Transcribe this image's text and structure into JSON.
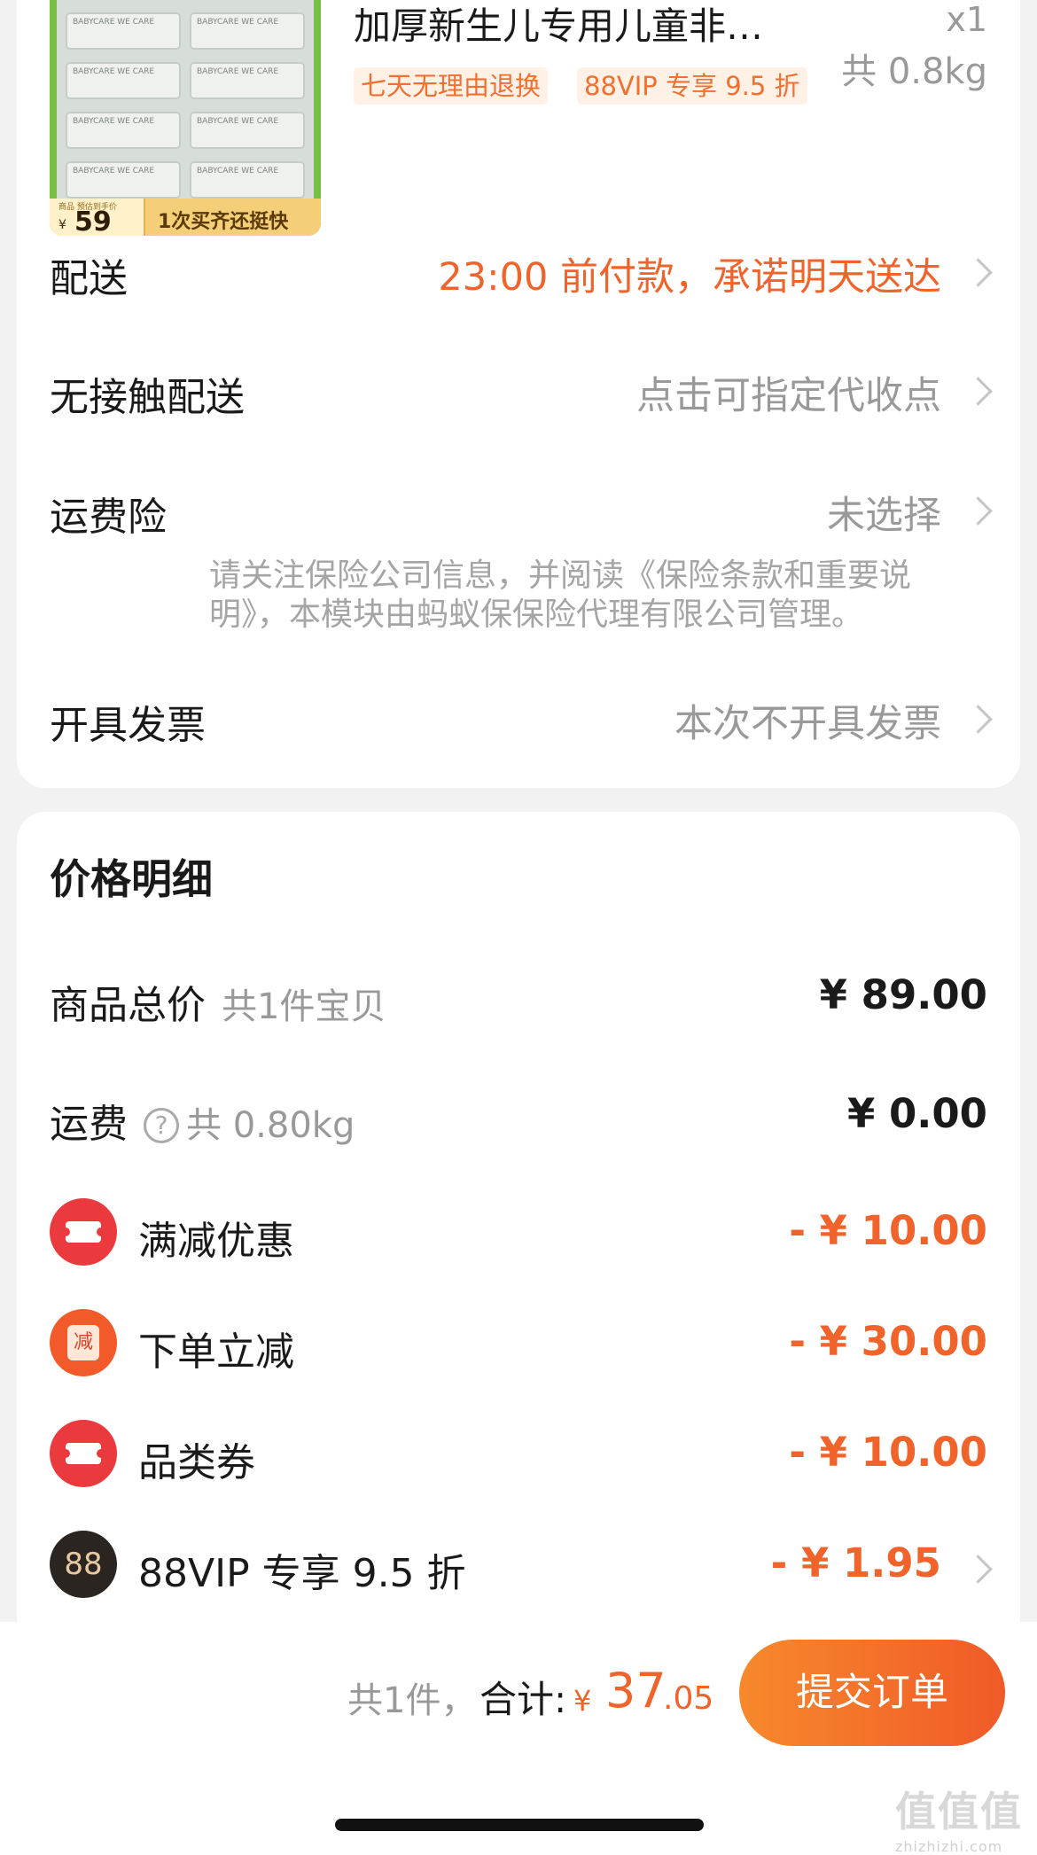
{
  "product": {
    "image_price": "59",
    "image_price_yen": "¥",
    "image_small_text": "商品 预估到手价",
    "image_slogan": "1次买齐还挺快",
    "pack_label": "BABYCARE WE CARE",
    "title": "加厚新生儿专用儿童非…",
    "qty": "x1",
    "weight": "共 0.8kg",
    "tags": [
      "七天无理由退换",
      "88VIP 专享 9.5 折"
    ]
  },
  "options": [
    {
      "label": "配送",
      "value": "23:00 前付款，承诺明天送达",
      "highlight": true
    },
    {
      "label": "无接触配送",
      "value": "点击可指定代收点",
      "highlight": false
    },
    {
      "label": "运费险",
      "value": "未选择",
      "highlight": false
    },
    {
      "label": "开具发票",
      "value": "本次不开具发票",
      "highlight": false
    }
  ],
  "insurance_note": "请关注保险公司信息，并阅读《保险条款和重要说明》，本模块由蚂蚁保保险代理有限公司管理。",
  "price_detail": {
    "title": "价格明细",
    "goods_total": {
      "label": "商品总价",
      "sub": "共1件宝贝",
      "amount": "¥ 89.00"
    },
    "shipping": {
      "label": "运费",
      "help_icon": "?",
      "sub": "共 0.80kg",
      "amount": "¥ 0.00"
    },
    "discounts": [
      {
        "label": "满减优惠",
        "amount": "- ¥ 10.00",
        "icon": "ticket-icon",
        "color": "#eb3a3e"
      },
      {
        "label": "下单立减",
        "amount": "- ¥ 30.00",
        "icon": "jian-icon",
        "icon_text": "减",
        "color": "#f35a2a"
      },
      {
        "label": "品类券",
        "amount": "- ¥ 10.00",
        "icon": "ticket-icon",
        "color": "#eb3a3e"
      },
      {
        "label": "88VIP 专享 9.5 折",
        "amount": "- ¥ 1.95",
        "icon": "88vip-icon",
        "icon_text": "88",
        "color": "#2b2522"
      }
    ]
  },
  "footer": {
    "count": "共1件，",
    "total_label": "合计:",
    "yen": "¥",
    "total_int": "37",
    "total_dec": ".05",
    "submit_label": "提交订单",
    "watermark_big": "值值值",
    "watermark_small": "zhizhizhi.com"
  },
  "colors": {
    "accent": "#f0632a",
    "muted": "#999999",
    "background": "#f2f2f2"
  }
}
